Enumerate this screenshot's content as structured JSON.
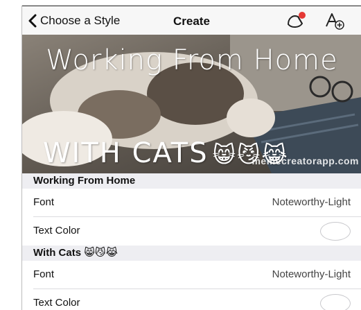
{
  "nav": {
    "back_label": "Choose a Style",
    "title": "Create",
    "sticker_icon": "sticker-icon",
    "text_style_icon": "text-add-icon"
  },
  "image": {
    "top_caption": "Working From Home",
    "bottom_caption": "WITH CATS",
    "bottom_caption_emojis": "😸😼😹",
    "watermark": "memecreatorapp.com"
  },
  "sections": [
    {
      "header": "Working From Home",
      "rows": [
        {
          "label": "Font",
          "value": "Noteworthy-Light"
        },
        {
          "label": "Text Color",
          "value": ""
        }
      ]
    },
    {
      "header": "With Cats 😸😼😹",
      "rows": [
        {
          "label": "Font",
          "value": "Noteworthy-Light"
        },
        {
          "label": "Text Color",
          "value": ""
        }
      ]
    }
  ],
  "colors": {
    "accent_red": "#e53935",
    "text_color_swatch": "#ffffff"
  }
}
